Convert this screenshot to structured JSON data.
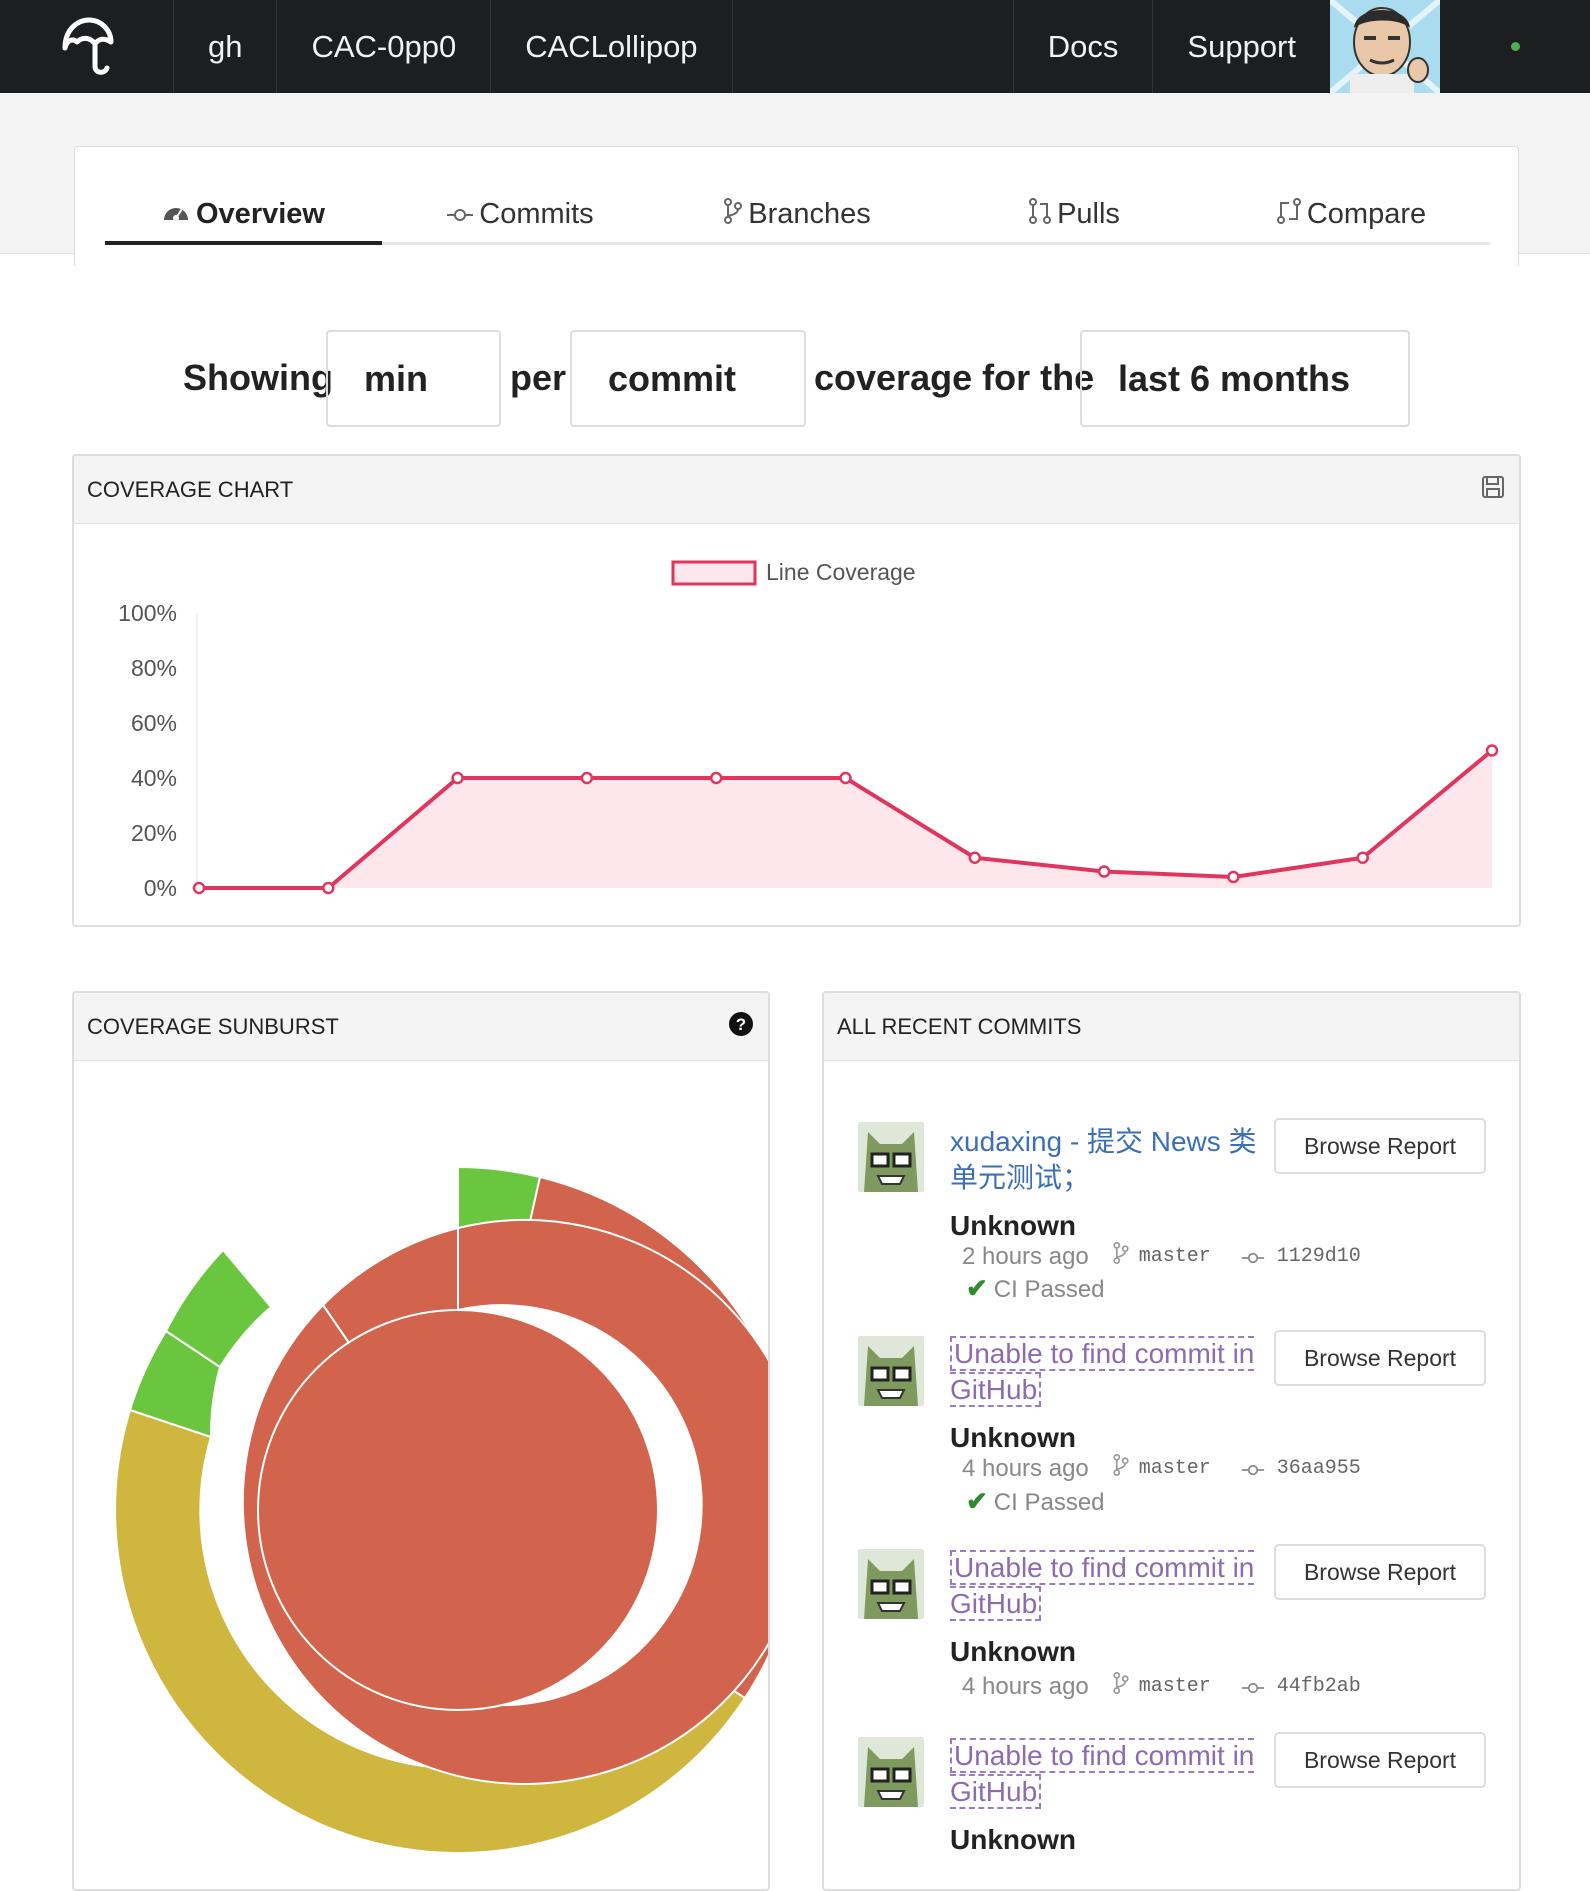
{
  "topbar": {
    "items": [
      "gh",
      "CAC-0pp0",
      "CACLollipop"
    ],
    "right_items": [
      "Docs",
      "Support"
    ],
    "logo_icon": "umbrella-logo-icon",
    "status_color": "#4caf50"
  },
  "tabs": [
    {
      "label": "Overview",
      "icon": "dashboard-icon",
      "active": true
    },
    {
      "label": "Commits",
      "icon": "commit-icon",
      "active": false
    },
    {
      "label": "Branches",
      "icon": "branch-icon",
      "active": false
    },
    {
      "label": "Pulls",
      "icon": "pull-request-icon",
      "active": false
    },
    {
      "label": "Compare",
      "icon": "compare-icon",
      "active": false
    }
  ],
  "filter": {
    "showing": "Showing",
    "agg": "min",
    "per": "per",
    "unit": "commit",
    "coverage_for_the": "coverage for the",
    "range": "last 6 months"
  },
  "coverage_chart": {
    "title": "COVERAGE CHART",
    "save_icon": "save-icon"
  },
  "chart_data": {
    "type": "area",
    "series": [
      {
        "name": "Line Coverage",
        "values": [
          0,
          0,
          40,
          40,
          40,
          40,
          11,
          6,
          4,
          11,
          50
        ],
        "color": "#e0365e",
        "fill": "#fde6ec"
      }
    ],
    "x": [
      0,
      1,
      2,
      3,
      4,
      5,
      6,
      7,
      8,
      9,
      10
    ],
    "ylim": [
      0,
      100
    ],
    "yticks": [
      "100%",
      "80%",
      "60%",
      "40%",
      "20%",
      "0%"
    ],
    "legend": "top-center",
    "grid": false
  },
  "sunburst": {
    "title": "COVERAGE SUNBURST",
    "help_icon": "question-circle-icon",
    "colors": {
      "red": "#d2634c",
      "yellow": "#cfb63f",
      "green": "#6ac63f"
    }
  },
  "commits_panel": {
    "title": "ALL RECENT COMMITS",
    "browse_label": "Browse Report",
    "commits": [
      {
        "title": "xudaxing - 提交 News 类单元测试；",
        "found": true,
        "author": "Unknown",
        "time": "2 hours ago",
        "branch": "master",
        "sha": "1129d10",
        "ci": "CI Passed"
      },
      {
        "title": "Unable to find commit in GitHub",
        "found": false,
        "author": "Unknown",
        "time": "4 hours ago",
        "branch": "master",
        "sha": "36aa955",
        "ci": "CI Passed"
      },
      {
        "title": "Unable to find commit in GitHub",
        "found": false,
        "author": "Unknown",
        "time": "4 hours ago",
        "branch": "master",
        "sha": "44fb2ab",
        "ci": ""
      },
      {
        "title": "Unable to find commit in GitHub",
        "found": false,
        "author": "Unknown",
        "time": "",
        "branch": "",
        "sha": "",
        "ci": ""
      }
    ]
  }
}
